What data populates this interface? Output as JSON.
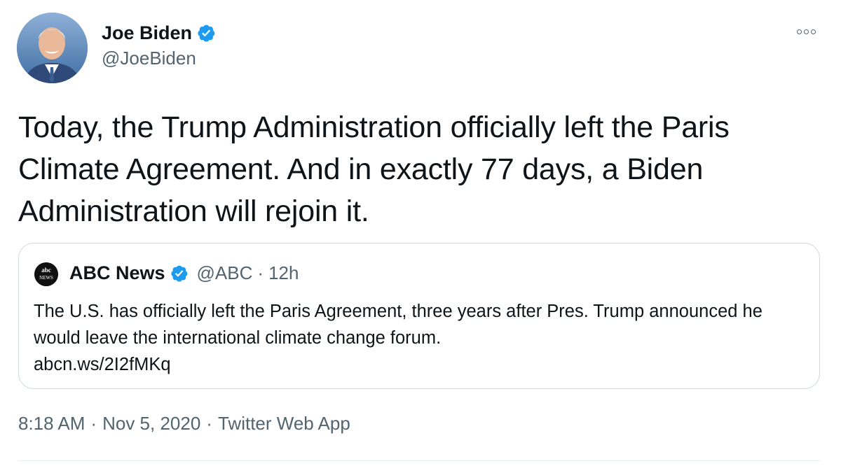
{
  "author": {
    "name": "Joe Biden",
    "handle": "@JoeBiden",
    "verified": true
  },
  "tweet": {
    "text": "Today, the Trump Administration officially left the Paris Climate Agreement. And in exactly 77 days, a Biden Administration will rejoin it."
  },
  "quoted": {
    "name": "ABC News",
    "handle": "@ABC",
    "separator": "·",
    "time": "12h",
    "avatar_text": "abc NEWS",
    "text": "The U.S. has officially left the Paris Agreement, three years after Pres. Trump announced he would leave the international climate change forum.",
    "link": "abcn.ws/2I2fMKq",
    "verified": true
  },
  "meta": {
    "time": "8:18 AM",
    "separator": "·",
    "date": "Nov 5, 2020",
    "app": "Twitter Web App"
  },
  "colors": {
    "verified_badge": "#1d9bf0",
    "secondary_text": "#536471",
    "primary_text": "#0f1419",
    "border": "#cfd9de"
  },
  "icons": {
    "more": "more-options-icon",
    "verified": "verified-badge-icon"
  }
}
